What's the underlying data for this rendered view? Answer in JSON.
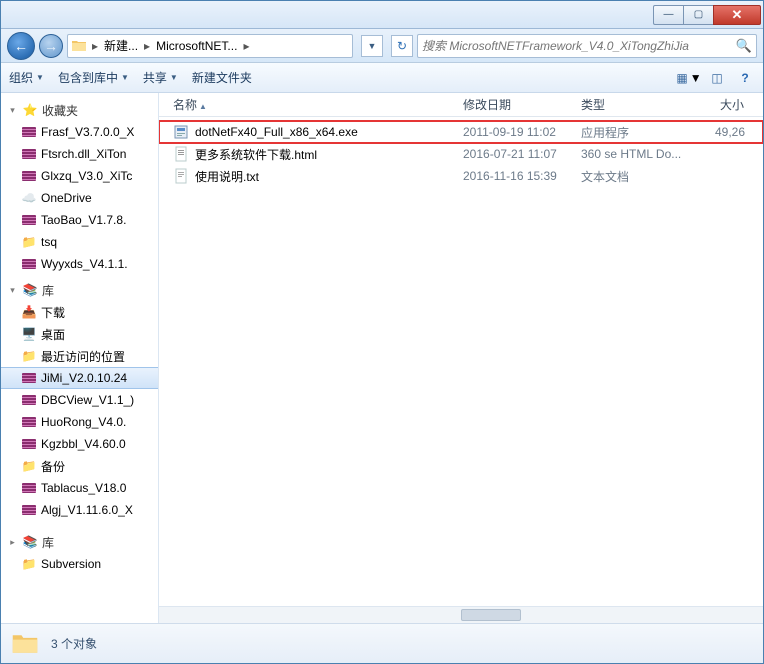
{
  "titlebar": {
    "min": "—",
    "max": "▢",
    "close": "✕"
  },
  "breadcrumb": {
    "seg1": "新建...",
    "seg2": "MicrosoftNET..."
  },
  "search": {
    "placeholder": "搜索 MicrosoftNETFramework_V4.0_XiTongZhiJia"
  },
  "toolbar": {
    "organize": "组织",
    "include": "包含到库中",
    "share": "共享",
    "newfolder": "新建文件夹"
  },
  "columns": {
    "name": "名称",
    "date": "修改日期",
    "type": "类型",
    "size": "大小"
  },
  "files": [
    {
      "name": "dotNetFx40_Full_x86_x64.exe",
      "date": "2011-09-19 11:02",
      "type": "应用程序",
      "size": "49,26",
      "icon": "installer",
      "highlight": true
    },
    {
      "name": "更多系统软件下载.html",
      "date": "2016-07-21 11:07",
      "type": "360 se HTML Do...",
      "size": "",
      "icon": "html",
      "highlight": false
    },
    {
      "name": "使用说明.txt",
      "date": "2016-11-16 15:39",
      "type": "文本文档",
      "size": "",
      "icon": "txt",
      "highlight": false
    }
  ],
  "sidebar": {
    "favorites": "收藏夹",
    "fav_items": [
      "Frasf_V3.7.0.0_X",
      "Ftsrch.dll_XiTon",
      "Glxzq_V3.0_XiTc",
      "OneDrive",
      "TaoBao_V1.7.8.",
      "tsq",
      "Wyyxds_V4.1.1."
    ],
    "libraries": "库",
    "lib_items": [
      "下载",
      "桌面",
      "最近访问的位置",
      "JiMi_V2.0.10.24",
      "DBCView_V1.1_)",
      "HuoRong_V4.0.",
      "Kgzbbl_V4.60.0",
      "备份",
      "Tablacus_V18.0",
      "Algj_V1.11.6.0_X"
    ],
    "libraries2": "库",
    "lib2_items": [
      "Subversion"
    ]
  },
  "status": {
    "text": "3 个对象"
  }
}
